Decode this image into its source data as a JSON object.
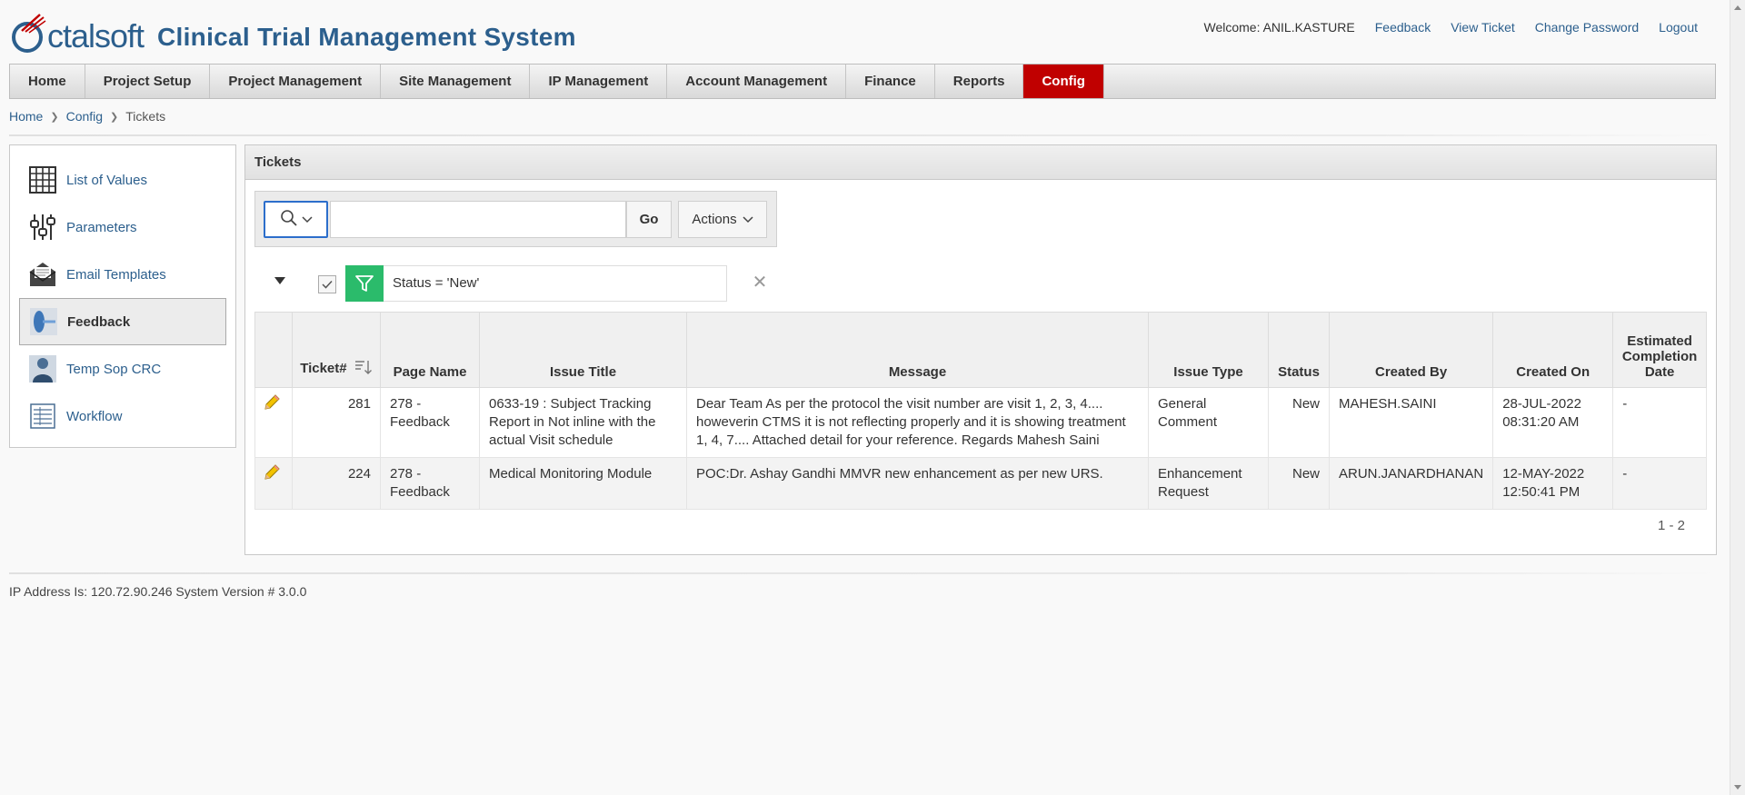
{
  "header": {
    "logo_text": "ctalsoft",
    "app_title": "Clinical Trial Management System",
    "welcome": "Welcome: ANIL.KASTURE",
    "links": [
      "Feedback",
      "View Ticket",
      "Change Password",
      "Logout"
    ]
  },
  "nav": {
    "items": [
      "Home",
      "Project Setup",
      "Project Management",
      "Site Management",
      "IP Management",
      "Account Management",
      "Finance",
      "Reports",
      "Config"
    ],
    "active": "Config",
    "active_color": "#c00000"
  },
  "breadcrumb": [
    "Home",
    "Config",
    "Tickets"
  ],
  "sidebar": {
    "items": [
      {
        "label": "List of Values",
        "icon": "grid-icon"
      },
      {
        "label": "Parameters",
        "icon": "sliders-icon"
      },
      {
        "label": "Email Templates",
        "icon": "envelope-icon"
      },
      {
        "label": "Feedback",
        "icon": "feedback-icon"
      },
      {
        "label": "Temp Sop CRC",
        "icon": "person-icon"
      },
      {
        "label": "Workflow",
        "icon": "workflow-icon"
      }
    ],
    "active": "Feedback"
  },
  "panel": {
    "title": "Tickets",
    "search": {
      "value": "",
      "placeholder": ""
    },
    "go_label": "Go",
    "actions_label": "Actions",
    "filter": {
      "text": "Status = 'New'",
      "enabled": true,
      "color": "#2bbb6b"
    }
  },
  "table": {
    "columns": [
      "",
      "Ticket#",
      "Page Name",
      "Issue Title",
      "Message",
      "Issue Type",
      "Status",
      "Created By",
      "Created On",
      "Estimated Completion Date"
    ],
    "rows": [
      {
        "ticket": "281",
        "page_name": "278 - Feedback",
        "issue_title": "0633-19 : Subject Tracking Report in Not inline with the actual Visit schedule",
        "message": "Dear Team As per the protocol the visit number are visit 1, 2, 3, 4.... howeverin CTMS it is not reflecting properly and it is showing treatment 1, 4, 7.... Attached detail for your reference. Regards Mahesh Saini",
        "issue_type": "General Comment",
        "status": "New",
        "created_by": "MAHESH.SAINI",
        "created_on": "28-JUL-2022 08:31:20 AM",
        "est_completion": "-"
      },
      {
        "ticket": "224",
        "page_name": "278 - Feedback",
        "issue_title": "Medical Monitoring Module",
        "message": "POC:Dr. Ashay Gandhi MMVR new enhancement as per new URS.",
        "issue_type": "Enhancement Request",
        "status": "New",
        "created_by": "ARUN.JANARDHANAN",
        "created_on": "12-MAY-2022 12:50:41 PM",
        "est_completion": "-"
      }
    ],
    "pagination": "1 - 2"
  },
  "footer": {
    "text": "IP Address Is: 120.72.90.246 System Version # 3.0.0"
  }
}
